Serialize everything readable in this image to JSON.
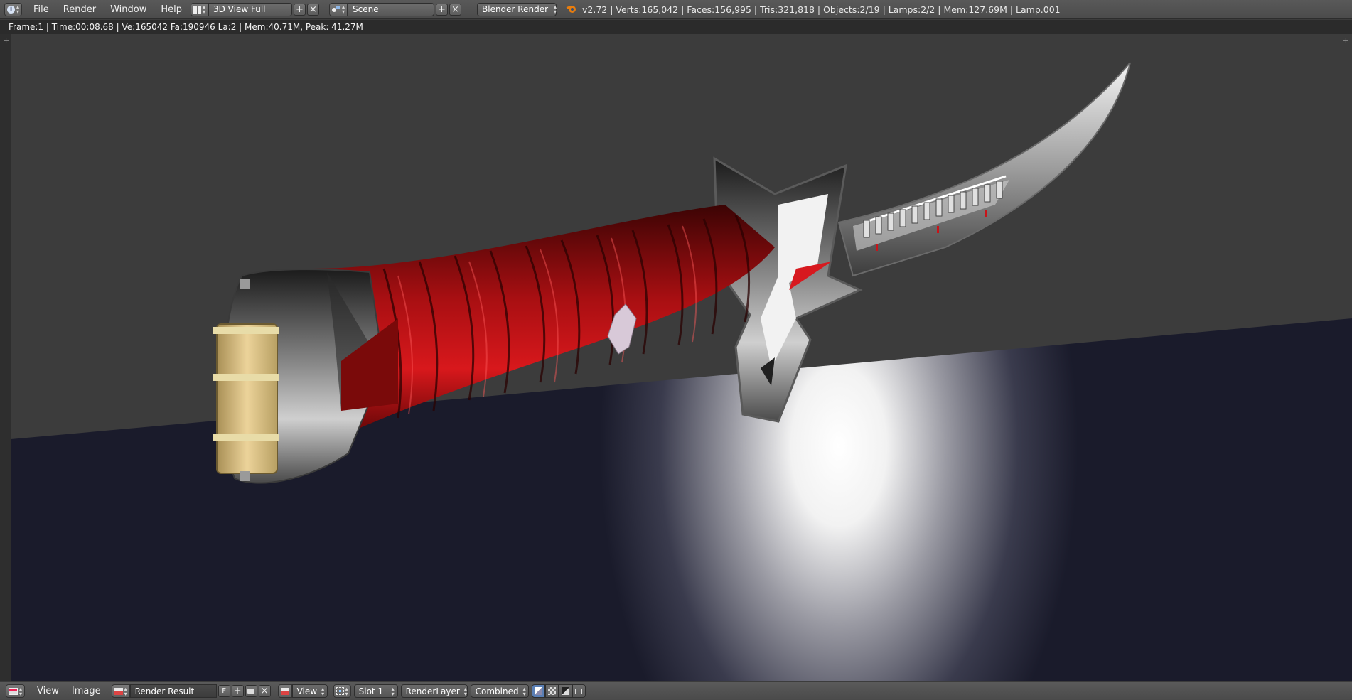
{
  "top": {
    "menus": [
      "File",
      "Render",
      "Window",
      "Help"
    ],
    "screen_layout": "3D View Full",
    "scene": "Scene",
    "engine": "Blender Render",
    "stats": "v2.72 | Verts:165,042 | Faces:156,995 | Tris:321,818 | Objects:2/19 | Lamps:2/2 | Mem:127.69M | Lamp.001"
  },
  "render_info": "Frame:1 | Time:00:08.68 | Ve:165042 Fa:190946 La:2 | Mem:40.71M, Peak: 41.27M",
  "bottom": {
    "menus": [
      "View",
      "Image"
    ],
    "image_name": "Render Result",
    "fake_user": "F",
    "view": "View",
    "slot": "Slot 1",
    "layer": "RenderLayer",
    "pass": "Combined"
  },
  "icons": {
    "info_editor": "info-icon",
    "layout": "screen-layout-icon",
    "scene": "scene-icon",
    "engine": "blender-logo-icon",
    "image_editor": "image-editor-icon"
  },
  "colors": {
    "header_bg": "#4f4f4f",
    "viewport_bg": "#3c3c3c",
    "floor": "#1a1b2b",
    "handle_wrap": "#8c0b0b",
    "blade": "#b8b8b8",
    "pommel_gold": "#d9bf7f"
  }
}
